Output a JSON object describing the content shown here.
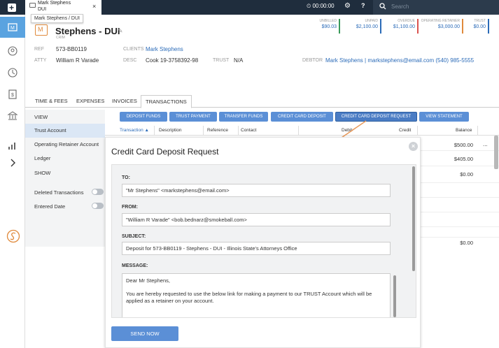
{
  "topbar": {
    "tab_title": "Mark Stephens",
    "tab_subtitle": "DUI",
    "tab_close": "×",
    "tooltip": "Mark Stephens / DUI",
    "timer": "⏲ 00:00:00",
    "search_placeholder": "Search"
  },
  "matter": {
    "title": "Stephens - DUI",
    "subtitle": "CRIM",
    "ref_label": "REF",
    "ref_value": "573-BB0119",
    "atty_label": "ATTY",
    "atty_value": "William R Varade",
    "clients_label": "CLIENTS",
    "clients_value": "Mark Stephens",
    "desc_label": "DESC",
    "desc_value": "Cook 19-3758392-98",
    "trust_label": "TRUST",
    "trust_value": "N/A",
    "debtor_label": "DEBTOR",
    "debtor_value": "Mark Stephens | markstephens@email.com (540) 985-5555"
  },
  "financials": [
    {
      "label": "Unbilled",
      "value": "$90.03",
      "color": "#3a9a5a"
    },
    {
      "label": "Unpaid",
      "value": "$2,100.00",
      "color": "#2b6bb8"
    },
    {
      "label": "Overdue",
      "value": "$1,100.00",
      "color": "#d9534f"
    },
    {
      "label": "Operating Retainer",
      "value": "$3,000.00",
      "color": "#e08a3c"
    },
    {
      "label": "Trust",
      "value": "$0.00",
      "color": "#2b6bb8"
    }
  ],
  "subtabs": [
    "TIME & FEES",
    "EXPENSES",
    "INVOICES",
    "TRANSACTIONS"
  ],
  "leftpanel": {
    "view_heading": "VIEW",
    "items": [
      "Trust Account",
      "Operating Retainer Account",
      "Ledger"
    ],
    "show_heading": "SHOW",
    "toggles": [
      "Deleted Transactions",
      "Entered Date"
    ]
  },
  "actions": [
    "DEPOSIT FUNDS",
    "TRUST PAYMENT",
    "TRANSFER FUNDS",
    "CREDIT CARD DEPOSIT",
    "CREDIT CARD DEPOSIT REQUEST",
    "VIEW STATEMENT"
  ],
  "table": {
    "headers": [
      "Transaction",
      "Description",
      "Reference",
      "Contact",
      "Debit",
      "Credit",
      "Balance"
    ],
    "sort_indicator": "▲",
    "balances": [
      "$500.00",
      "$405.00",
      "$0.00",
      "$0.00"
    ],
    "row_menu": "..."
  },
  "modal": {
    "title": "Credit Card Deposit Request",
    "close_symbol": "×",
    "to_label": "TO:",
    "to_value": "\"Mr Stephens\" <markstephens@email.com>",
    "from_label": "FROM:",
    "from_value": "\"William R Varade\" <bob.bednarz@smokeball.com>",
    "subject_label": "SUBJECT:",
    "subject_value": "Deposit for 573-BB0119 - Stephens - DUI - Illinois State's Attorneys Office",
    "message_label": "MESSAGE:",
    "message_greeting": "Dear Mr Stephens,",
    "message_body": "You are hereby requested to use the below link for making a payment to our TRUST Account which will be applied as a retainer on your account.",
    "send_button": "SEND NOW"
  },
  "colors": {
    "accent": "#5b8fd6",
    "topbar": "#1f2d3d",
    "arrow": "#e8995a"
  }
}
